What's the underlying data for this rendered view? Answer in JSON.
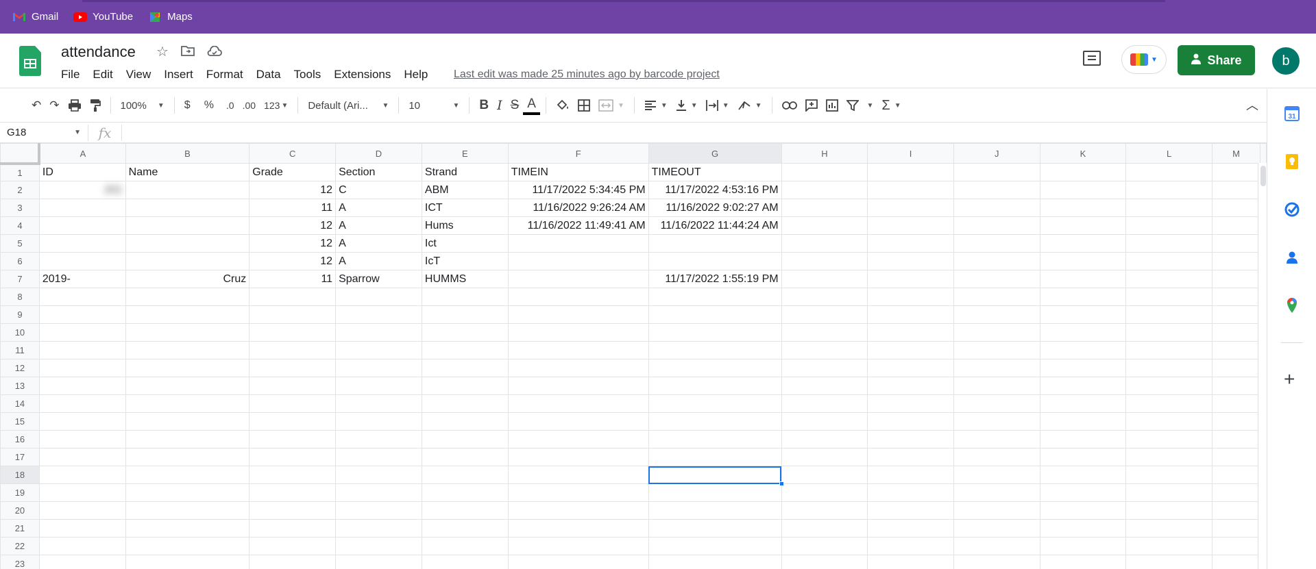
{
  "bookmarks": [
    {
      "label": "Gmail",
      "icon": "gmail-icon"
    },
    {
      "label": "YouTube",
      "icon": "youtube-icon"
    },
    {
      "label": "Maps",
      "icon": "maps-icon"
    }
  ],
  "header": {
    "title": "attendance",
    "menu": [
      "File",
      "Edit",
      "View",
      "Insert",
      "Format",
      "Data",
      "Tools",
      "Extensions",
      "Help"
    ],
    "last_edit": "Last edit was made 25 minutes ago by barcode project",
    "share_label": "Share",
    "avatar_letter": "b"
  },
  "toolbar": {
    "zoom": "100%",
    "currency": "$",
    "percent": "%",
    "decrease_decimal": ".0",
    "increase_decimal": ".00",
    "more_formats": "123",
    "font": "Default (Ari...",
    "font_size": "10",
    "bold": "B",
    "italic": "I",
    "strike": "S",
    "text_color": "A",
    "sum": "Σ"
  },
  "formula_bar": {
    "name_box": "G18",
    "fx": "fx",
    "content": ""
  },
  "grid": {
    "columns": [
      "A",
      "B",
      "C",
      "D",
      "E",
      "F",
      "G",
      "H",
      "I",
      "J",
      "K",
      "L",
      "M"
    ],
    "selected_column": "G",
    "selected_row": 18,
    "row_count": 23,
    "rows": [
      [
        "ID",
        "Name",
        "Grade",
        "Section",
        "Strand",
        "TIMEIN",
        "TIMEOUT"
      ],
      [
        "201",
        "",
        "12",
        "C",
        "ABM",
        "11/17/2022 5:34:45 PM",
        "11/17/2022 4:53:16 PM"
      ],
      [
        "",
        "",
        "11",
        "A",
        "ICT",
        "11/16/2022 9:26:24 AM",
        "11/16/2022 9:02:27 AM"
      ],
      [
        "",
        "",
        "12",
        "A",
        "Hums",
        "11/16/2022 11:49:41 AM",
        "11/16/2022 11:44:24 AM"
      ],
      [
        "",
        "",
        "12",
        "A",
        "Ict",
        "",
        ""
      ],
      [
        "",
        "",
        "12",
        "A",
        "IcT",
        "",
        ""
      ],
      [
        "2019-",
        "Cruz",
        "11",
        "Sparrow",
        "HUMMS",
        "",
        "11/17/2022 1:55:19 PM"
      ]
    ]
  },
  "side_panel": [
    "calendar-icon",
    "keep-icon",
    "tasks-icon",
    "contacts-icon",
    "maps-icon",
    "add-icon"
  ]
}
